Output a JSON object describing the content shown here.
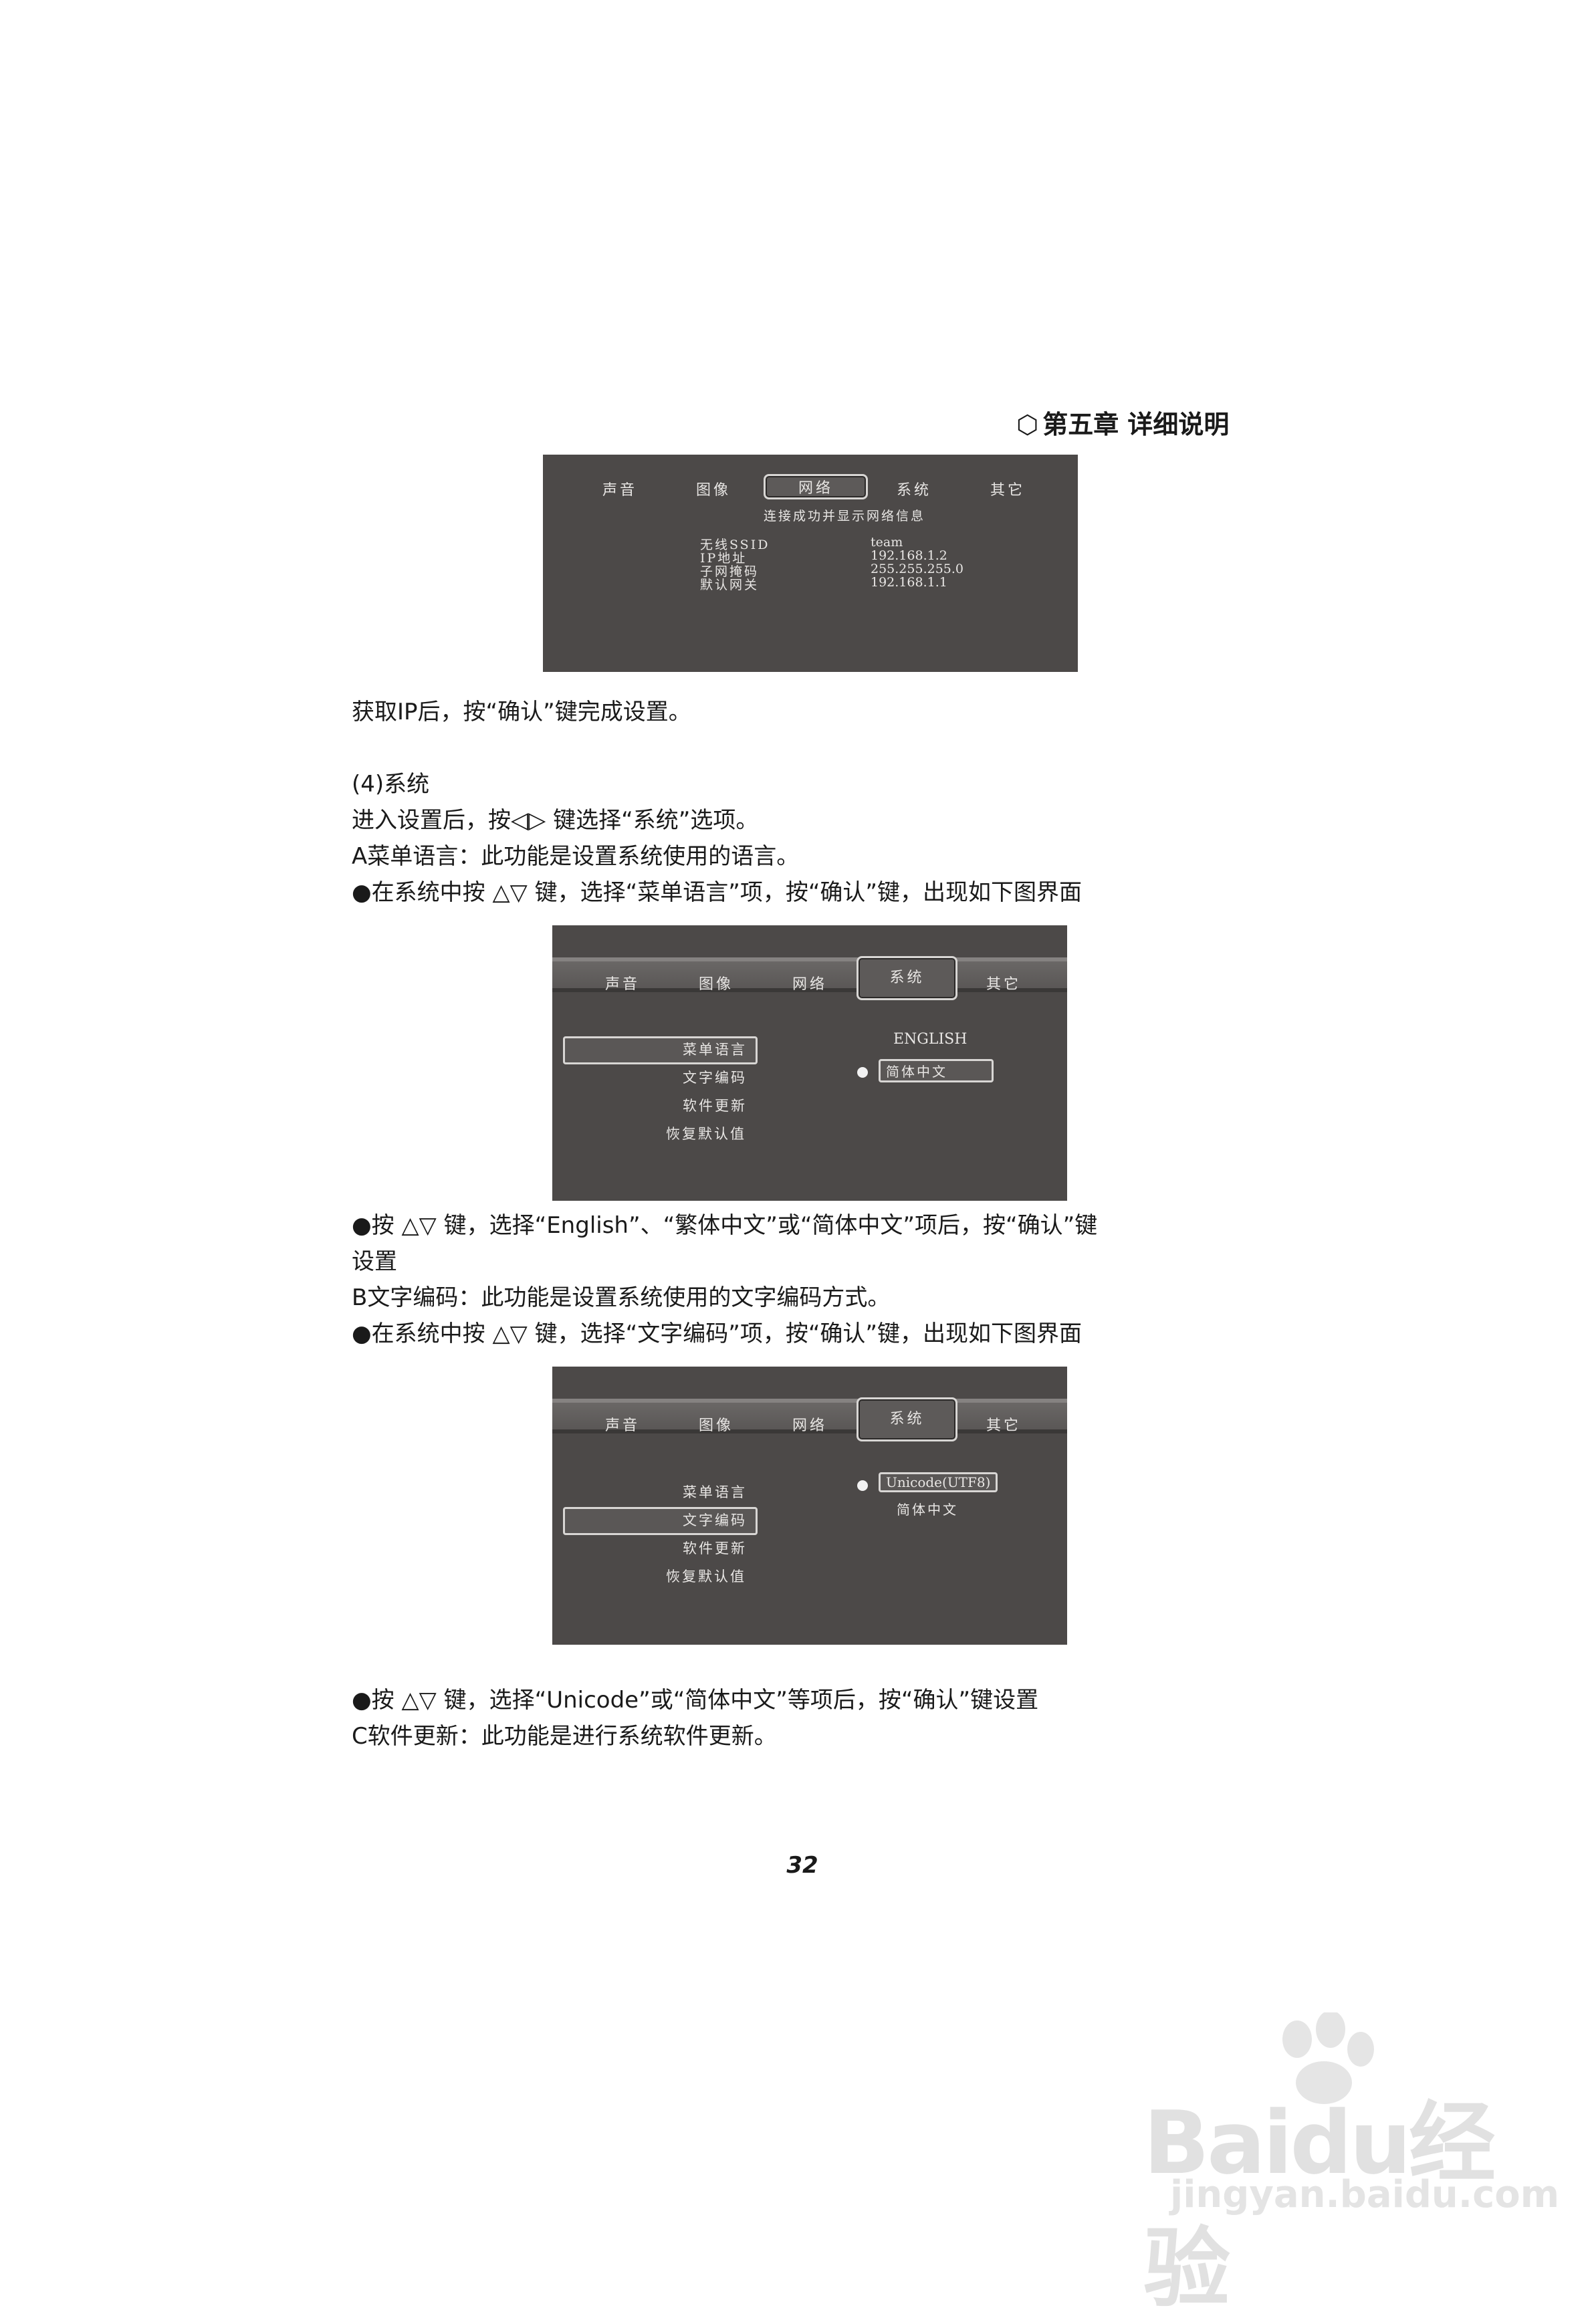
{
  "chapter_header": "第五章 详细说明",
  "screen1": {
    "tabs": [
      "声音",
      "图像",
      "网络",
      "系统",
      "其它"
    ],
    "subtitle": "连接成功并显示网络信息",
    "rows": [
      {
        "label": "无线SSID",
        "value": "team"
      },
      {
        "label": "IP地址",
        "value": "192.168.1.2"
      },
      {
        "label": "子网掩码",
        "value": "255.255.255.0"
      },
      {
        "label": "默认网关",
        "value": "192.168.1.1"
      }
    ]
  },
  "para_after_screen1": "获取IP后，按“确认”键完成设置。",
  "section_system": {
    "heading": "(4)系统",
    "intro_before": "进入设置后，按",
    "intro_after": " 键选择“系统”选项。",
    "a_title": "A菜单语言：此功能是设置系统使用的语言。",
    "a_step1_before": "●在系统中按 ",
    "a_step1_after": " 键，选择“菜单语言”项，按“确认”键，出现如下图界面"
  },
  "screen2": {
    "tabs": [
      "声音",
      "图像",
      "网络",
      "系统",
      "其它"
    ],
    "menu": [
      "菜单语言",
      "文字编码",
      "软件更新",
      "恢复默认值"
    ],
    "options": [
      "ENGLISH",
      "简体中文"
    ]
  },
  "para_a_step2_line1_before": "●按 ",
  "para_a_step2_line1_after": " 键，选择“English”、“繁体中文”或“简体中文”项后，按“确认”键",
  "para_a_step2_line2": "设置",
  "b_title": "B文字编码：此功能是设置系统使用的文字编码方式。",
  "b_step1_before": "●在系统中按 ",
  "b_step1_after": " 键，选择“文字编码”项，按“确认”键，出现如下图界面",
  "screen3": {
    "tabs": [
      "声音",
      "图像",
      "网络",
      "系统",
      "其它"
    ],
    "menu": [
      "菜单语言",
      "文字编码",
      "软件更新",
      "恢复默认值"
    ],
    "options": [
      "Unicode(UTF8)",
      "简体中文"
    ]
  },
  "b_step2_before": "●按 ",
  "b_step2_after": " 键，选择“Unicode”或“简体中文”等项后，按“确认”键设置",
  "c_title": "C软件更新：此功能是进行系统软件更新。",
  "page_number": "32",
  "watermark": {
    "brand": "Baidu经验",
    "sub": "jingyan.baidu.com"
  },
  "symbols": {
    "left_right": "◁▷",
    "up_down": "△▽"
  }
}
